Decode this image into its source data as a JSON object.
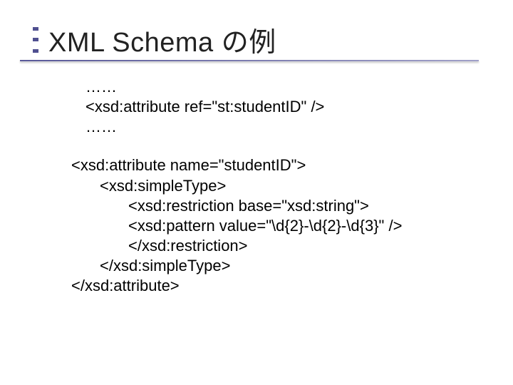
{
  "title": "XML Schema の例",
  "snippet1": {
    "l1": "……",
    "l2": "<xsd:attribute ref=\"st:studentID\" />",
    "l3": "……"
  },
  "snippet2": {
    "l1": "<xsd:attribute name=\"studentID\">",
    "l2": "<xsd:simpleType>",
    "l3": "<xsd:restriction base=\"xsd:string\">",
    "l4": "<xsd:pattern value=\"\\d{2}-\\d{2}-\\d{3}\" />",
    "l5": "</xsd:restriction>",
    "l6": "</xsd:simpleType>",
    "l7": "</xsd:attribute>"
  }
}
